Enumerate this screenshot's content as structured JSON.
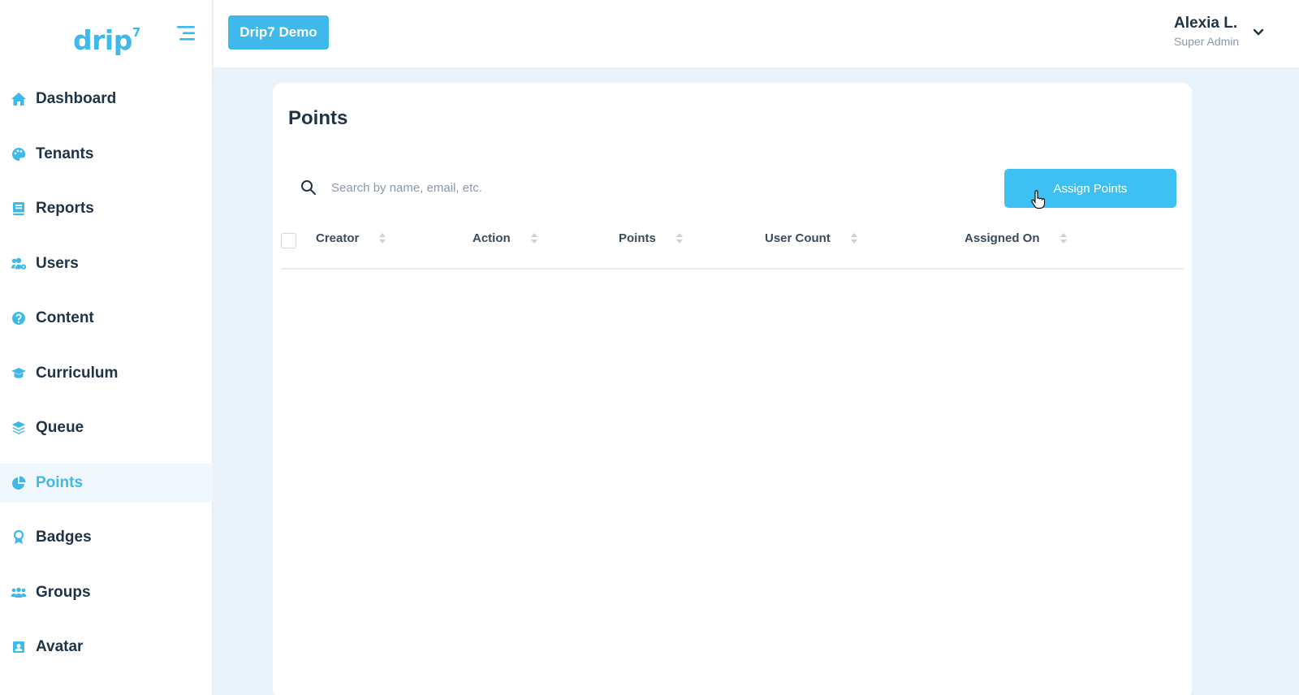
{
  "sidebar": {
    "logo_text": "drip",
    "logo_sup": "7",
    "items": [
      {
        "label": "Dashboard",
        "icon": "home-icon"
      },
      {
        "label": "Tenants",
        "icon": "palette-icon"
      },
      {
        "label": "Reports",
        "icon": "book-icon"
      },
      {
        "label": "Users",
        "icon": "users-cog-icon"
      },
      {
        "label": "Content",
        "icon": "question-circle-icon"
      },
      {
        "label": "Curriculum",
        "icon": "graduation-cap-icon"
      },
      {
        "label": "Queue",
        "icon": "layers-icon"
      },
      {
        "label": "Points",
        "icon": "pie-chart-icon",
        "active": true
      },
      {
        "label": "Badges",
        "icon": "award-icon"
      },
      {
        "label": "Groups",
        "icon": "group-icon"
      },
      {
        "label": "Avatar",
        "icon": "portrait-icon"
      }
    ]
  },
  "header": {
    "tenant_label": "Drip7 Demo",
    "user_name": "Alexia L.",
    "user_role": "Super Admin"
  },
  "main": {
    "title": "Points",
    "search_placeholder": "Search by name, email, etc.",
    "assign_button": "Assign Points",
    "columns": [
      "Creator",
      "Action",
      "Points",
      "User Count",
      "Assigned On"
    ],
    "rows": []
  },
  "colors": {
    "accent": "#3fb8ea",
    "text": "#1f3347",
    "background": "#eaf2f9"
  }
}
